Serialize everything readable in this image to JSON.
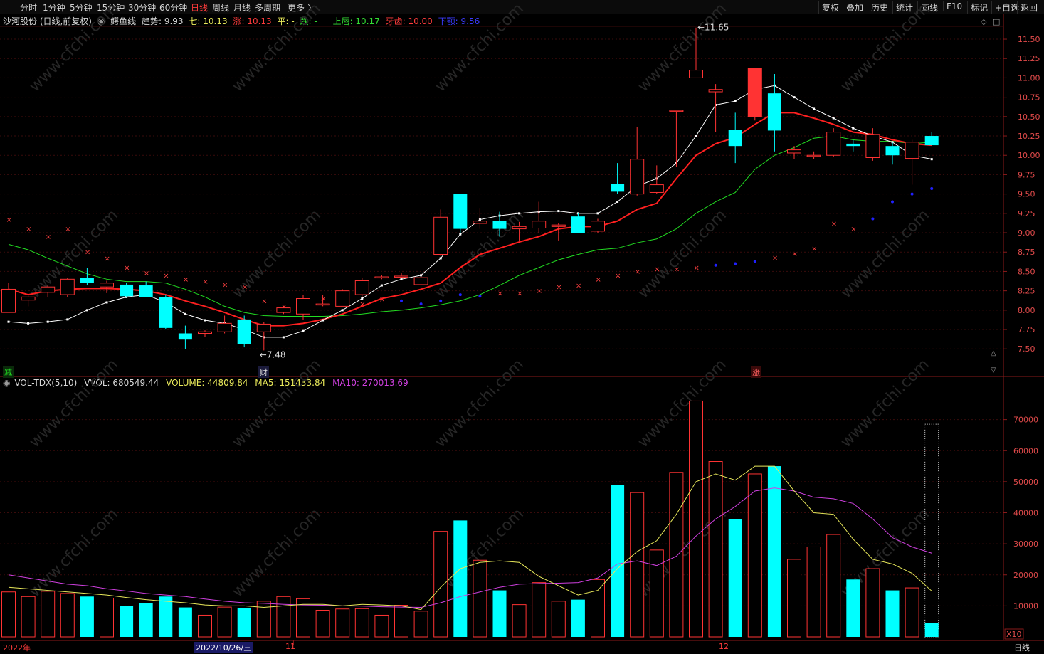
{
  "toolbar": {
    "periods": [
      "分时",
      "1分钟",
      "5分钟",
      "15分钟",
      "30分钟",
      "60分钟",
      "日线",
      "周线",
      "月线",
      "多周期",
      "更多 〉"
    ],
    "active_period": "日线",
    "right_buttons": [
      "复权",
      "叠加",
      "历史",
      "统计",
      "画线",
      "F10",
      "标记",
      "+自选",
      "返回"
    ]
  },
  "info": {
    "stock": "沙河股份 (日线,前复权)",
    "indicator": "鳄鱼线",
    "trend_label": "趋势: 9.93",
    "qi_label": "七:",
    "qi_val": "10.13",
    "zhang_label": "涨: 10.13",
    "ping_label": "平: -",
    "die_label": "跌: -",
    "shangchun_label": "上唇: 10.17",
    "yachi_label": "牙齿: 10.00",
    "xiae_label": "下颚: 9.56"
  },
  "volume": {
    "title": "VOL-TDX(5,10)",
    "vvol": "VVOL: 680549.44",
    "vol": "VOLUME: 44809.84",
    "ma5": "MA5: 151433.84",
    "ma10": "MA10: 270013.69"
  },
  "price_axis": [
    "11.50",
    "11.25",
    "11.00",
    "10.75",
    "10.50",
    "10.25",
    "10.00",
    "9.75",
    "9.50",
    "9.25",
    "9.00",
    "8.75",
    "8.50",
    "8.25",
    "8.00",
    "7.75",
    "7.50"
  ],
  "volume_axis": [
    "70000",
    "60000",
    "50000",
    "40000",
    "30000",
    "20000",
    "10000"
  ],
  "volume_unit": "X10",
  "annotations": {
    "high": "11.65",
    "low": "7.48"
  },
  "markers": {
    "jian": "减",
    "cai": "财",
    "zhang": "涨"
  },
  "bottom_axis": {
    "year": "2022年",
    "cursor_date": "2022/10/26/三",
    "nov": "11",
    "dec": "12",
    "period": "日线"
  },
  "watermark": "www.cfchi.com",
  "colors": {
    "up": "#ff3333",
    "down": "#00ffff",
    "ma_white": "#ffffff",
    "ma_red": "#ff2020",
    "ma_green": "#22dd22",
    "vol_ma5": "#e8e85a",
    "vol_ma10": "#d040e0",
    "sar_up": "#ff4040",
    "sar_down": "#2020ff"
  },
  "chart_data": {
    "type": "candlestick",
    "candles": [
      {
        "o": 7.97,
        "h": 8.35,
        "l": 7.97,
        "c": 8.27
      },
      {
        "o": 8.13,
        "h": 8.2,
        "l": 8.05,
        "c": 8.17
      },
      {
        "o": 8.23,
        "h": 8.32,
        "l": 8.17,
        "c": 8.3
      },
      {
        "o": 8.2,
        "h": 8.42,
        "l": 8.17,
        "c": 8.4
      },
      {
        "o": 8.42,
        "h": 8.55,
        "l": 8.32,
        "c": 8.35
      },
      {
        "o": 8.3,
        "h": 8.38,
        "l": 8.22,
        "c": 8.35
      },
      {
        "o": 8.33,
        "h": 8.35,
        "l": 8.17,
        "c": 8.18
      },
      {
        "o": 8.32,
        "h": 8.37,
        "l": 8.17,
        "c": 8.17
      },
      {
        "o": 8.17,
        "h": 8.2,
        "l": 7.75,
        "c": 7.77
      },
      {
        "o": 7.7,
        "h": 7.8,
        "l": 7.5,
        "c": 7.62
      },
      {
        "o": 7.7,
        "h": 7.74,
        "l": 7.65,
        "c": 7.72
      },
      {
        "o": 7.72,
        "h": 7.93,
        "l": 7.7,
        "c": 7.83
      },
      {
        "o": 7.88,
        "h": 7.93,
        "l": 7.52,
        "c": 7.56
      },
      {
        "o": 7.72,
        "h": 7.85,
        "l": 7.48,
        "c": 7.82
      },
      {
        "o": 7.97,
        "h": 8.05,
        "l": 7.95,
        "c": 8.03
      },
      {
        "o": 7.95,
        "h": 8.2,
        "l": 7.87,
        "c": 8.15
      },
      {
        "o": 8.07,
        "h": 8.2,
        "l": 8.05,
        "c": 8.08
      },
      {
        "o": 8.05,
        "h": 8.27,
        "l": 8.05,
        "c": 8.25
      },
      {
        "o": 8.2,
        "h": 8.42,
        "l": 8.17,
        "c": 8.38
      },
      {
        "o": 8.43,
        "h": 8.45,
        "l": 8.4,
        "c": 8.43
      },
      {
        "o": 8.43,
        "h": 8.48,
        "l": 8.41,
        "c": 8.44
      },
      {
        "o": 8.33,
        "h": 8.48,
        "l": 8.32,
        "c": 8.42
      },
      {
        "o": 8.72,
        "h": 9.3,
        "l": 8.7,
        "c": 9.2
      },
      {
        "o": 9.5,
        "h": 9.5,
        "l": 9.0,
        "c": 9.05
      },
      {
        "o": 9.12,
        "h": 9.32,
        "l": 9.05,
        "c": 9.15
      },
      {
        "o": 9.15,
        "h": 9.27,
        "l": 8.95,
        "c": 9.05
      },
      {
        "o": 9.05,
        "h": 9.14,
        "l": 8.9,
        "c": 9.08
      },
      {
        "o": 9.06,
        "h": 9.4,
        "l": 9.0,
        "c": 9.15
      },
      {
        "o": 9.08,
        "h": 9.12,
        "l": 8.9,
        "c": 9.1
      },
      {
        "o": 9.21,
        "h": 9.25,
        "l": 9.0,
        "c": 9.0
      },
      {
        "o": 9.02,
        "h": 9.18,
        "l": 9.0,
        "c": 9.15
      },
      {
        "o": 9.63,
        "h": 9.9,
        "l": 9.5,
        "c": 9.53
      },
      {
        "o": 9.5,
        "h": 10.37,
        "l": 9.48,
        "c": 9.95
      },
      {
        "o": 9.52,
        "h": 9.87,
        "l": 9.5,
        "c": 9.62
      },
      {
        "o": 10.58,
        "h": 10.58,
        "l": 9.85,
        "c": 10.58
      },
      {
        "o": 11.0,
        "h": 11.65,
        "l": 11.0,
        "c": 11.1
      },
      {
        "o": 10.82,
        "h": 10.92,
        "l": 10.3,
        "c": 10.85
      },
      {
        "o": 10.33,
        "h": 10.55,
        "l": 9.9,
        "c": 10.12
      },
      {
        "o": 10.5,
        "h": 11.12,
        "l": 10.45,
        "c": 11.12
      },
      {
        "o": 10.8,
        "h": 11.05,
        "l": 10.05,
        "c": 10.32
      },
      {
        "o": 10.03,
        "h": 10.12,
        "l": 9.95,
        "c": 10.07
      },
      {
        "o": 10.0,
        "h": 10.05,
        "l": 9.95,
        "c": 10.0
      },
      {
        "o": 10.0,
        "h": 10.35,
        "l": 9.98,
        "c": 10.3
      },
      {
        "o": 10.15,
        "h": 10.2,
        "l": 10.05,
        "c": 10.12
      },
      {
        "o": 9.97,
        "h": 10.35,
        "l": 9.93,
        "c": 10.27
      },
      {
        "o": 10.12,
        "h": 10.17,
        "l": 9.88,
        "c": 10.0
      },
      {
        "o": 9.96,
        "h": 10.2,
        "l": 9.62,
        "c": 10.17
      },
      {
        "o": 10.25,
        "h": 10.3,
        "l": 10.13,
        "c": 10.13
      }
    ],
    "ma_white": [
      7.85,
      7.83,
      7.85,
      7.88,
      8.0,
      8.1,
      8.17,
      8.2,
      8.1,
      7.95,
      7.87,
      7.83,
      7.75,
      7.65,
      7.65,
      7.73,
      7.87,
      8.0,
      8.15,
      8.32,
      8.4,
      8.45,
      8.67,
      8.98,
      9.17,
      9.22,
      9.25,
      9.27,
      9.28,
      9.25,
      9.25,
      9.4,
      9.6,
      9.7,
      9.9,
      10.25,
      10.65,
      10.7,
      10.85,
      10.9,
      10.75,
      10.6,
      10.48,
      10.35,
      10.25,
      10.17,
      10.0,
      9.95
    ],
    "ma_red": [
      8.27,
      8.2,
      8.25,
      8.27,
      8.28,
      8.28,
      8.27,
      8.25,
      8.2,
      8.12,
      8.05,
      7.97,
      7.88,
      7.8,
      7.8,
      7.83,
      7.88,
      7.95,
      8.05,
      8.15,
      8.2,
      8.27,
      8.35,
      8.55,
      8.72,
      8.8,
      8.88,
      8.95,
      9.05,
      9.08,
      9.08,
      9.15,
      9.3,
      9.38,
      9.7,
      10.0,
      10.15,
      10.23,
      10.4,
      10.55,
      10.55,
      10.48,
      10.4,
      10.3,
      10.27,
      10.2,
      10.15,
      10.13
    ],
    "ma_green": [
      8.85,
      8.78,
      8.67,
      8.57,
      8.47,
      8.4,
      8.37,
      8.37,
      8.35,
      8.27,
      8.17,
      8.05,
      7.97,
      7.93,
      7.92,
      7.92,
      7.92,
      7.93,
      7.95,
      7.98,
      8.0,
      8.03,
      8.07,
      8.12,
      8.2,
      8.32,
      8.45,
      8.55,
      8.65,
      8.72,
      8.78,
      8.8,
      8.87,
      8.92,
      9.05,
      9.25,
      9.4,
      9.52,
      9.82,
      10.0,
      10.1,
      10.22,
      10.25,
      10.2,
      10.18,
      10.18,
      10.15,
      10.17
    ],
    "sar": [
      9.17,
      9.05,
      8.95,
      9.05,
      8.75,
      8.67,
      8.55,
      8.48,
      8.45,
      8.4,
      8.37,
      8.33,
      8.3,
      8.12,
      8.05,
      8.08,
      8.15,
      8.2,
      8.08,
      8.14,
      8.12,
      8.08,
      8.12,
      8.2,
      8.18,
      8.22,
      8.22,
      8.25,
      8.3,
      8.32,
      8.4,
      8.45,
      8.5,
      8.53,
      8.53,
      8.55,
      8.58,
      8.6,
      8.63,
      8.68,
      8.73,
      8.8,
      9.12,
      9.05,
      9.18,
      9.4,
      9.5,
      9.57
    ],
    "sar_up": [
      true,
      true,
      true,
      true,
      true,
      true,
      true,
      true,
      true,
      true,
      true,
      true,
      true,
      true,
      true,
      true,
      true,
      true,
      true,
      true,
      false,
      false,
      false,
      false,
      false,
      true,
      true,
      true,
      true,
      true,
      true,
      true,
      true,
      true,
      true,
      true,
      false,
      false,
      false,
      true,
      true,
      true,
      true,
      true,
      false,
      false,
      false,
      false
    ],
    "volume": [
      14500,
      13000,
      14700,
      14000,
      13000,
      12500,
      10000,
      11000,
      13000,
      9500,
      7000,
      9600,
      9400,
      11500,
      13000,
      12300,
      8600,
      9000,
      9100,
      7000,
      10200,
      8300,
      34000,
      37500,
      24700,
      15000,
      10400,
      17500,
      11500,
      12000,
      18500,
      49000,
      46500,
      28000,
      53000,
      76000,
      56500,
      38000,
      52500,
      55000,
      25000,
      29000,
      33000,
      18500,
      22000,
      15000,
      15800,
      4500
    ],
    "vol_ma5": [
      16000,
      15500,
      15000,
      14500,
      14000,
      13500,
      12700,
      12000,
      11500,
      11000,
      10300,
      10000,
      10000,
      9500,
      10000,
      10500,
      10500,
      10000,
      10500,
      10300,
      10000,
      8800,
      16000,
      22000,
      24000,
      24500,
      24000,
      19500,
      16500,
      13500,
      15000,
      22000,
      27500,
      31000,
      39500,
      50000,
      52500,
      50500,
      55000,
      55000,
      47000,
      40000,
      39500,
      31500,
      25000,
      23500,
      20500,
      14800
    ],
    "vol_ma10": [
      20000,
      19000,
      18000,
      17000,
      16500,
      15500,
      14800,
      14000,
      13500,
      13000,
      12200,
      11500,
      11000,
      10800,
      10500,
      10300,
      10200,
      10000,
      9900,
      9700,
      9600,
      9500,
      11000,
      13000,
      14500,
      16000,
      17000,
      17200,
      17300,
      17500,
      19000,
      23500,
      24500,
      23000,
      26000,
      32500,
      38000,
      42000,
      47000,
      48000,
      47000,
      45000,
      44500,
      43000,
      38000,
      32000,
      29000,
      27000
    ],
    "price_range": [
      7.3,
      11.73
    ],
    "volume_range": [
      0,
      80000
    ]
  }
}
